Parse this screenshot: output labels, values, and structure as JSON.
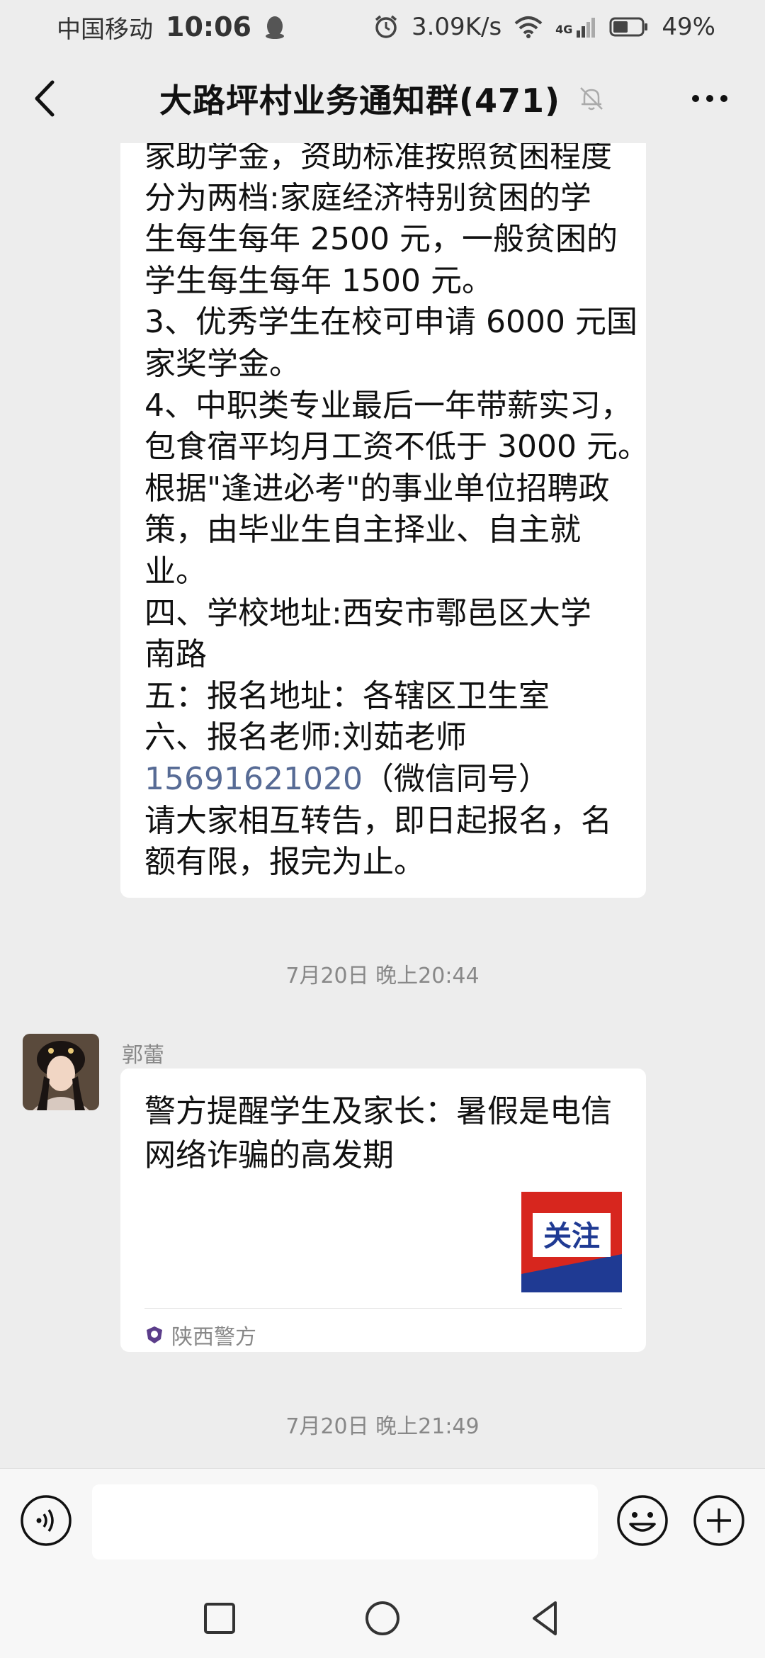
{
  "status_bar": {
    "carrier": "中国移动",
    "time": "10:06",
    "net_speed": "3.09K/s",
    "network": "4G",
    "battery": "49%"
  },
  "nav": {
    "title": "大路坪村业务通知群(471)"
  },
  "messages": {
    "notice_lines": [
      "家助学金，资助标准按照贫困程度",
      "分为两档:家庭经济特别贫困的学",
      "生每生每年 2500 元，一般贫困的",
      "学生每生每年 1500 元。",
      "3、优秀学生在校可申请 6000 元国",
      "家奖学金。",
      "4、中职类专业最后一年带薪实习，",
      "包食宿平均月工资不低于 3000 元。",
      "根据\"逢进必考\"的事业单位招聘政",
      "策，由毕业生自主择业、自主就",
      "业。",
      "四、学校地址:西安市鄠邑区大学",
      "南路",
      "五：报名地址：各辖区卫生室",
      "六、报名老师:刘茹老师"
    ],
    "phone": "15691621020",
    "phone_suffix": "（微信同号）",
    "notice_tail": [
      "请大家相互转告，即日起报名，名",
      "额有限，报完为止。"
    ],
    "timestamp_1": "7月20日 晚上20:44",
    "sender_name": "郭蕾",
    "card_title": "警方提醒学生及家长：暑假是电信网络诈骗的高发期",
    "card_thumb_text": "关注",
    "card_source": "陕西警方",
    "timestamp_2": "7月20日 晚上21:49"
  },
  "colors": {
    "background": "#ededed",
    "bubble": "#ffffff",
    "link": "#576b95",
    "thumb_blue": "#1f3a93",
    "thumb_red": "#d7261e"
  }
}
